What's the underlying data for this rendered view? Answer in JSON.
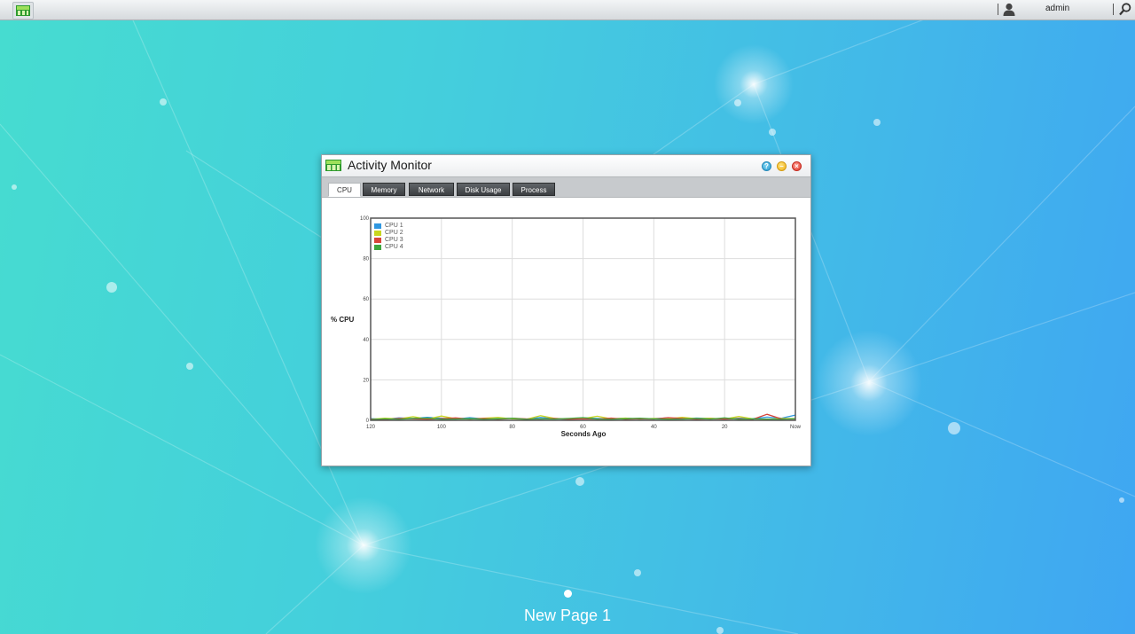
{
  "topbar": {
    "username": "admin"
  },
  "window": {
    "title": "Activity Monitor",
    "tabs": [
      {
        "label": "CPU",
        "active": true
      },
      {
        "label": "Memory",
        "active": false
      },
      {
        "label": "Network",
        "active": false
      },
      {
        "label": "Disk Usage",
        "active": false
      },
      {
        "label": "Process",
        "active": false
      }
    ]
  },
  "chart_data": {
    "type": "line",
    "ylabel": "% CPU",
    "xlabel": "Seconds Ago",
    "ylim": [
      0,
      100
    ],
    "yticks": [
      "0",
      "20",
      "40",
      "60",
      "80",
      "100"
    ],
    "xticks": [
      "120",
      "100",
      "80",
      "60",
      "40",
      "20",
      "Now"
    ],
    "x": [
      120,
      116,
      112,
      108,
      104,
      100,
      96,
      92,
      88,
      84,
      80,
      76,
      72,
      68,
      64,
      60,
      56,
      52,
      48,
      44,
      40,
      36,
      32,
      28,
      24,
      20,
      16,
      12,
      8,
      4,
      0
    ],
    "legend_position": "top-left",
    "grid": true,
    "series": [
      {
        "name": "CPU 1",
        "color": "#2f97e0",
        "values": [
          0.8,
          0.5,
          1.2,
          0.9,
          1.5,
          1.0,
          0.6,
          1.3,
          0.7,
          1.1,
          0.9,
          0.6,
          1.4,
          0.8,
          0.5,
          1.2,
          0.9,
          0.7,
          1.0,
          0.6,
          0.8,
          1.2,
          0.7,
          1.1,
          0.9,
          0.6,
          1.0,
          0.8,
          1.6,
          1.0,
          2.6
        ]
      },
      {
        "name": "CPU 2",
        "color": "#c8d61f",
        "values": [
          0.5,
          1.0,
          0.7,
          1.8,
          0.6,
          2.1,
          0.8,
          0.6,
          1.0,
          1.4,
          0.7,
          0.5,
          2.3,
          0.9,
          0.6,
          0.8,
          2.0,
          0.7,
          1.1,
          0.6,
          0.9,
          0.7,
          1.5,
          0.8,
          1.0,
          0.6,
          1.9,
          0.7,
          0.5,
          0.9,
          0.8
        ]
      },
      {
        "name": "CPU 3",
        "color": "#d8443a",
        "values": [
          0.6,
          0.4,
          0.9,
          0.7,
          0.5,
          0.8,
          1.2,
          0.6,
          0.9,
          0.5,
          1.0,
          0.7,
          0.6,
          0.9,
          0.5,
          0.7,
          0.6,
          1.1,
          0.5,
          0.8,
          0.6,
          1.3,
          0.9,
          0.5,
          0.7,
          0.6,
          0.8,
          0.5,
          3.0,
          0.7,
          0.6
        ]
      },
      {
        "name": "CPU 4",
        "color": "#3ea63e",
        "values": [
          0.4,
          0.7,
          0.5,
          0.9,
          1.1,
          0.5,
          0.6,
          0.8,
          0.5,
          0.7,
          1.0,
          0.5,
          0.7,
          0.6,
          0.9,
          1.3,
          0.6,
          0.5,
          0.8,
          1.0,
          0.7,
          0.5,
          0.6,
          0.9,
          0.6,
          1.2,
          0.5,
          0.7,
          0.6,
          0.5,
          0.8
        ]
      }
    ]
  },
  "desktop": {
    "page_label": "New Page 1"
  }
}
